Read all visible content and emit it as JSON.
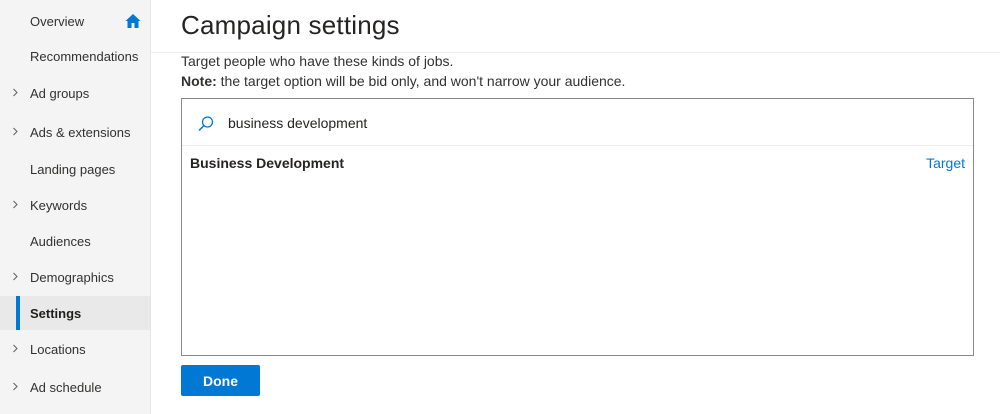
{
  "sidebar": {
    "items": [
      {
        "label": "Overview",
        "has_chevron": false,
        "active": false,
        "icon": "home-icon"
      },
      {
        "label": "Recommendations",
        "has_chevron": false,
        "active": false
      },
      {
        "label": "Ad groups",
        "has_chevron": true,
        "active": false
      },
      {
        "label": "Ads & extensions",
        "has_chevron": true,
        "active": false
      },
      {
        "label": "Landing pages",
        "has_chevron": false,
        "active": false
      },
      {
        "label": "Keywords",
        "has_chevron": true,
        "active": false
      },
      {
        "label": "Audiences",
        "has_chevron": false,
        "active": false
      },
      {
        "label": "Demographics",
        "has_chevron": true,
        "active": false
      },
      {
        "label": "Settings",
        "has_chevron": false,
        "active": true
      },
      {
        "label": "Locations",
        "has_chevron": true,
        "active": false
      },
      {
        "label": "Ad schedule",
        "has_chevron": true,
        "active": false
      }
    ]
  },
  "header": {
    "title": "Campaign settings"
  },
  "main": {
    "description": "Target people who have these kinds of jobs.",
    "note_label": "Note:",
    "note_text": " the target option will be bid only, and won't narrow your audience.",
    "search": {
      "value": "business development",
      "icon": "search-icon"
    },
    "results": [
      {
        "name": "Business Development",
        "action": "Target"
      }
    ],
    "done_label": "Done"
  },
  "colors": {
    "accent": "#0078d4",
    "sidebar_bg": "#f4f4f4",
    "active_bg": "#e9e9e9"
  }
}
